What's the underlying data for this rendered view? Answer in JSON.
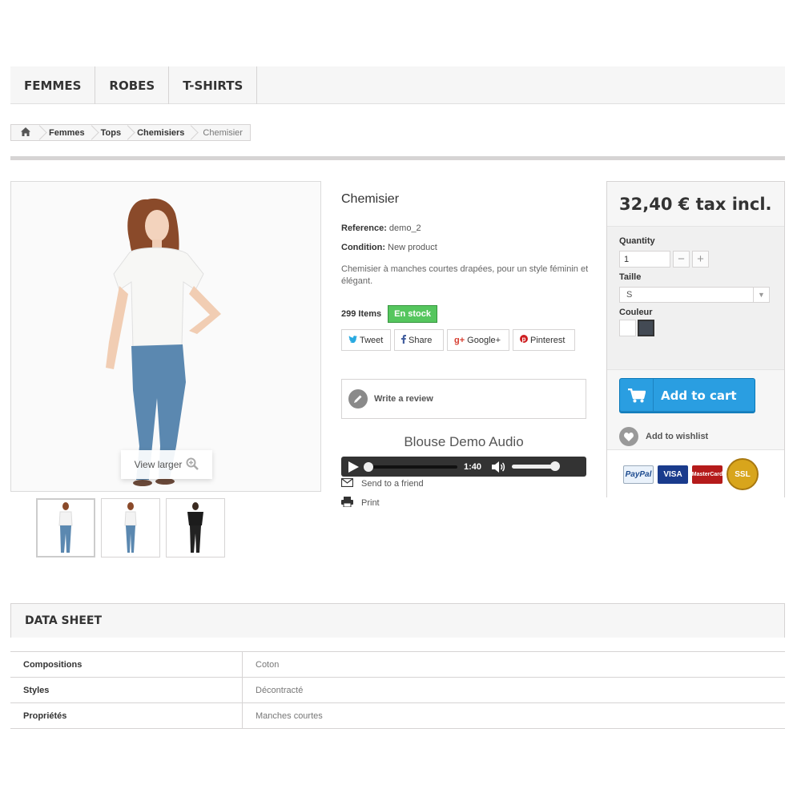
{
  "nav": [
    "FEMMES",
    "ROBES",
    "T-SHIRTS"
  ],
  "breadcrumb": {
    "home_icon": "home-icon",
    "items": [
      "Femmes",
      "Tops",
      "Chemisiers"
    ],
    "current": "Chemisier"
  },
  "image": {
    "view_larger": "View larger"
  },
  "product": {
    "title": "Chemisier",
    "reference_label": "Reference:",
    "reference": "demo_2",
    "condition_label": "Condition:",
    "condition": "New product",
    "description": "Chemisier à manches courtes drapées, pour un style féminin et élégant.",
    "items": "299 Items",
    "stock": "En stock"
  },
  "social": {
    "tweet": "Tweet",
    "share": "Share",
    "google": "Google+",
    "pinterest": "Pinterest"
  },
  "review": "Write a review",
  "audio": {
    "title": "Blouse Demo Audio",
    "time": "1:40",
    "progress": 0.0,
    "volume": 1.0
  },
  "links": {
    "send": "Send to a friend",
    "print": "Print"
  },
  "buy": {
    "price": "32,40 € tax incl.",
    "quantity_label": "Quantity",
    "quantity": "1",
    "size_label": "Taille",
    "size": "S",
    "color_label": "Couleur",
    "colors": [
      "#ffffff",
      "#434a54"
    ],
    "add_to_cart": "Add to cart",
    "wishlist": "Add to wishlist"
  },
  "payments": {
    "paypal": "PayPal",
    "visa": "VISA",
    "mastercard": "MasterCard",
    "ssl": "SSL"
  },
  "datasheet": {
    "title": "DATA SHEET",
    "rows": [
      {
        "key": "Compositions",
        "value": "Coton"
      },
      {
        "key": "Styles",
        "value": "Décontracté"
      },
      {
        "key": "Propriétés",
        "value": "Manches courtes"
      }
    ]
  },
  "colors": {
    "accent": "#2a9ee1",
    "stock": "#55c65e"
  }
}
